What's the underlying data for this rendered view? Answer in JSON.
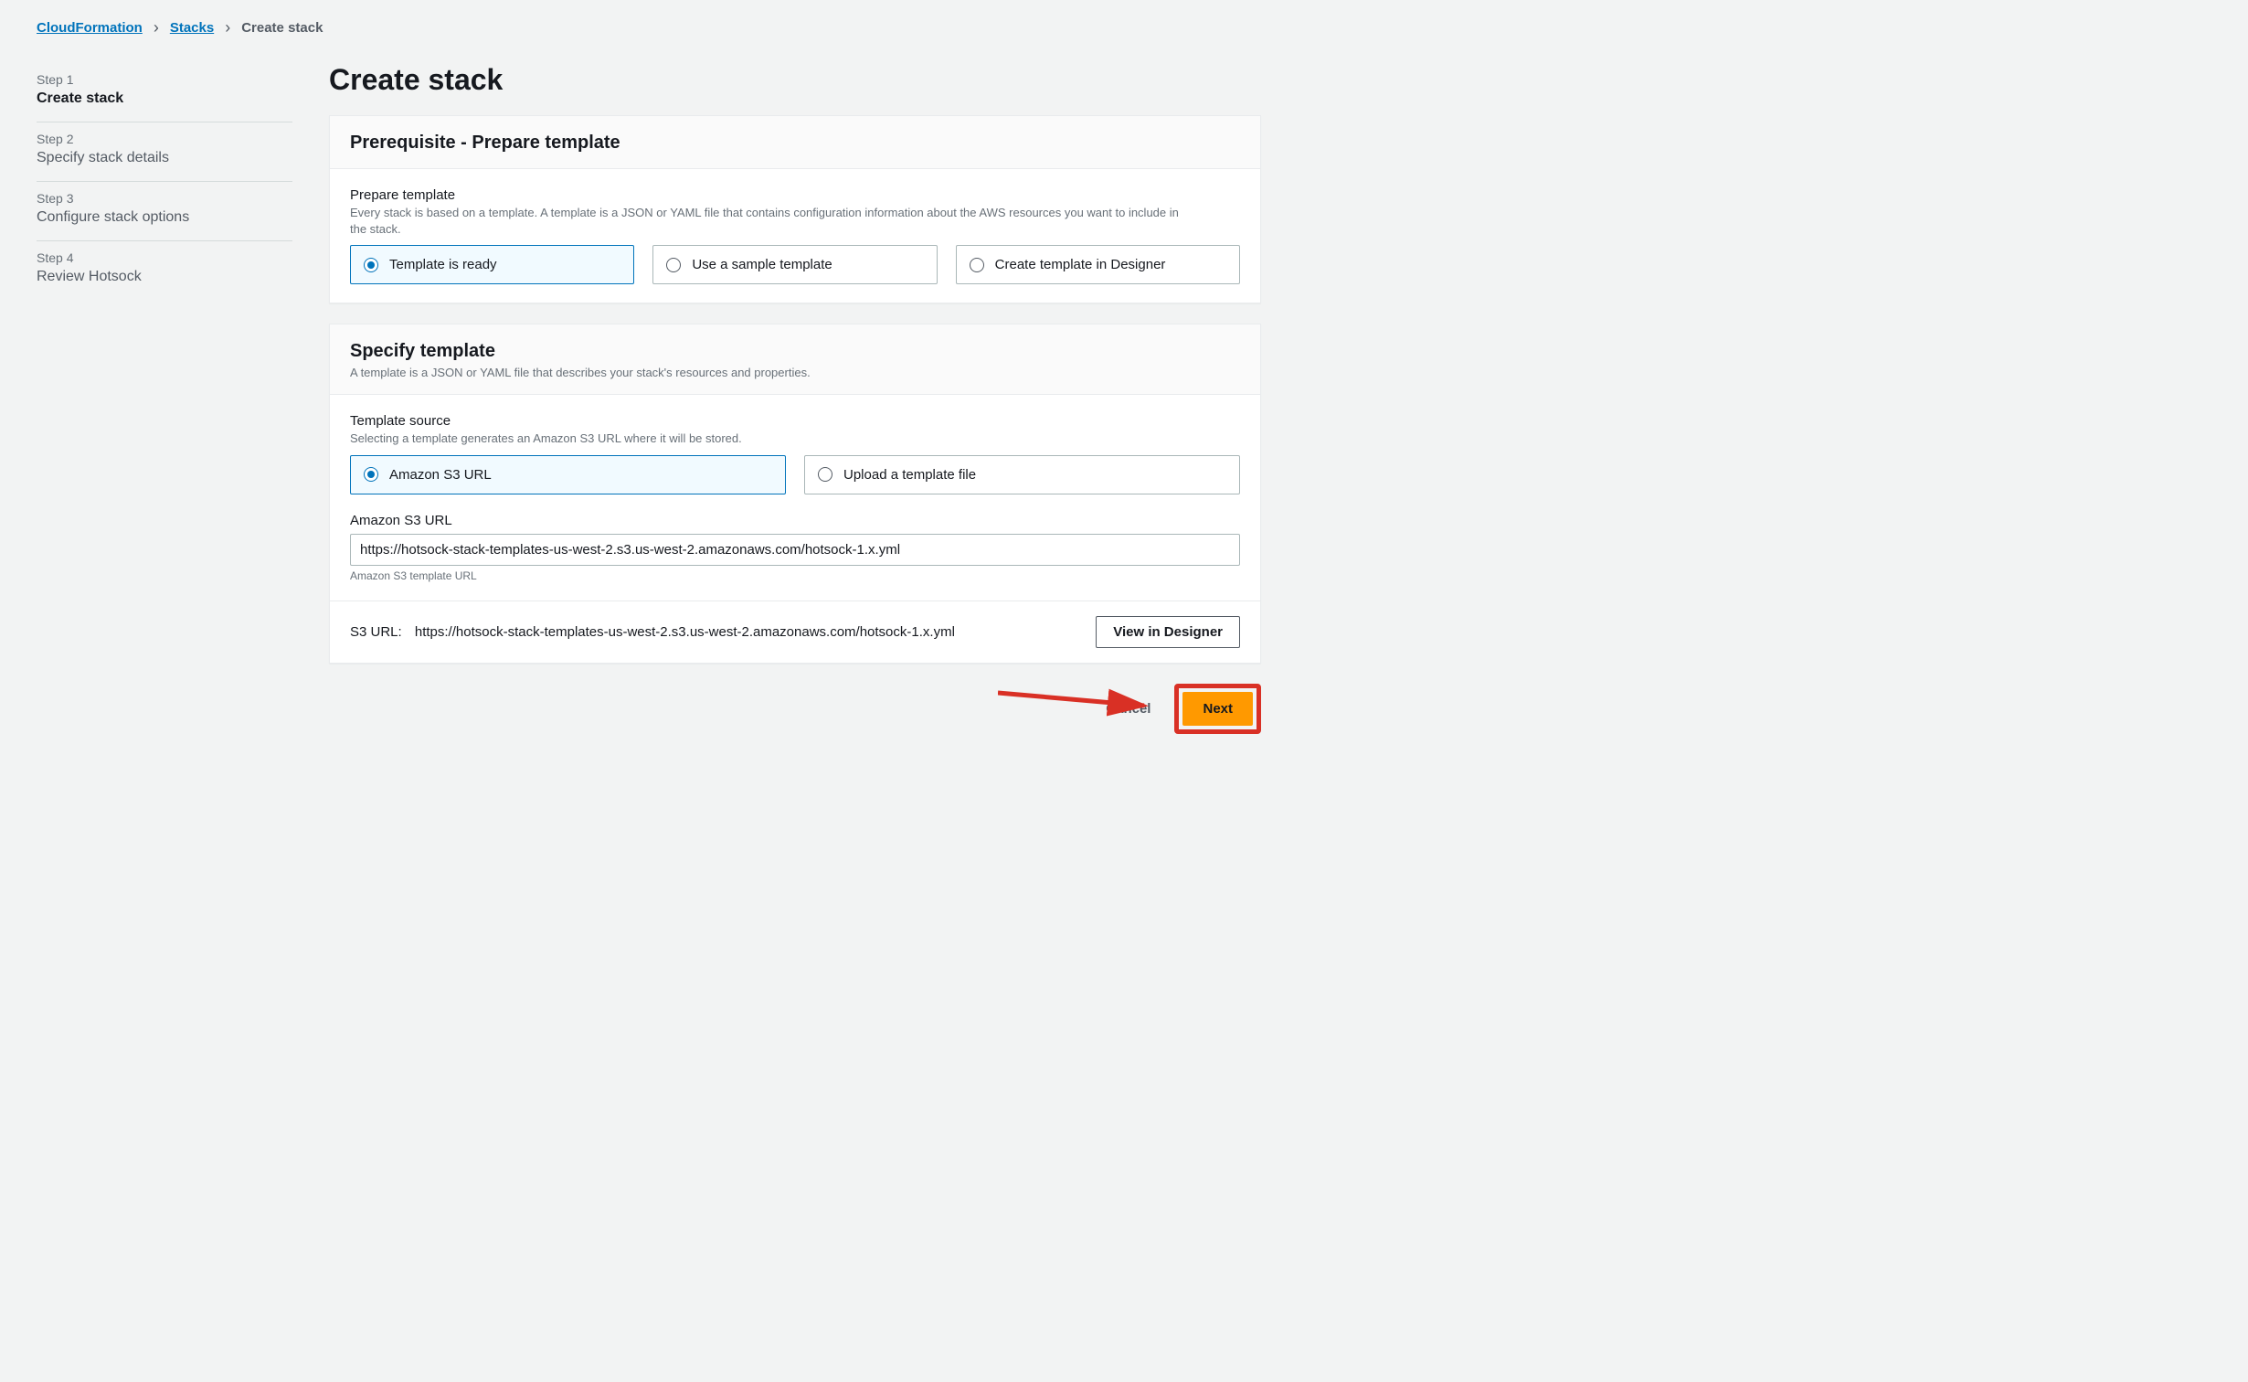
{
  "breadcrumb": {
    "items": [
      {
        "label": "CloudFormation",
        "link": true
      },
      {
        "label": "Stacks",
        "link": true
      },
      {
        "label": "Create stack",
        "link": false
      }
    ]
  },
  "sidebar": {
    "steps": [
      {
        "label": "Step 1",
        "title": "Create stack",
        "active": true
      },
      {
        "label": "Step 2",
        "title": "Specify stack details",
        "active": false
      },
      {
        "label": "Step 3",
        "title": "Configure stack options",
        "active": false
      },
      {
        "label": "Step 4",
        "title": "Review Hotsock",
        "active": false
      }
    ]
  },
  "page": {
    "title": "Create stack"
  },
  "prereq": {
    "heading": "Prerequisite - Prepare template",
    "field_label": "Prepare template",
    "field_help": "Every stack is based on a template. A template is a JSON or YAML file that contains configuration information about the AWS resources you want to include in the stack.",
    "options": [
      {
        "label": "Template is ready",
        "selected": true
      },
      {
        "label": "Use a sample template",
        "selected": false
      },
      {
        "label": "Create template in Designer",
        "selected": false
      }
    ]
  },
  "specify": {
    "heading": "Specify template",
    "sub": "A template is a JSON or YAML file that describes your stack's resources and properties.",
    "source_label": "Template source",
    "source_help": "Selecting a template generates an Amazon S3 URL where it will be stored.",
    "source_options": [
      {
        "label": "Amazon S3 URL",
        "selected": true
      },
      {
        "label": "Upload a template file",
        "selected": false
      }
    ],
    "url_label": "Amazon S3 URL",
    "url_value": "https://hotsock-stack-templates-us-west-2.s3.us-west-2.amazonaws.com/hotsock-1.x.yml",
    "url_hint": "Amazon S3 template URL",
    "summary_key": "S3 URL:",
    "summary_value": "https://hotsock-stack-templates-us-west-2.s3.us-west-2.amazonaws.com/hotsock-1.x.yml",
    "view_designer": "View in Designer"
  },
  "actions": {
    "cancel": "Cancel",
    "next": "Next"
  },
  "colors": {
    "accent": "#0073bb",
    "primary": "#ff9900",
    "callout": "#d93025"
  }
}
